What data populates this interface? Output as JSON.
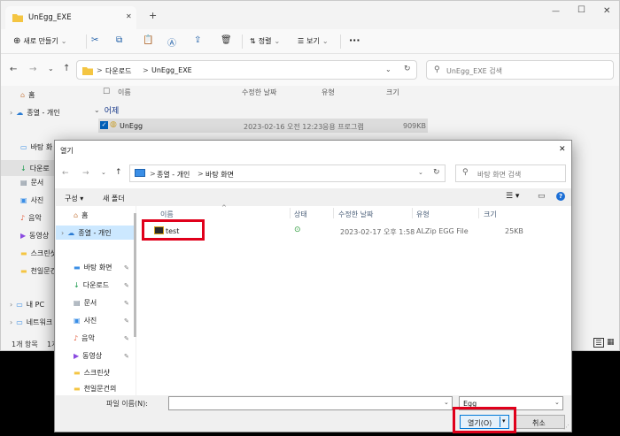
{
  "explorer": {
    "tab_title": "UnEgg_EXE",
    "toolbar": {
      "new_label": "새로 만들기",
      "sort_label": "정렬",
      "view_label": "보기",
      "more_label": "···"
    },
    "breadcrumb": {
      "sep1": ">",
      "part1": "다운로드",
      "sep2": ">",
      "part2": "UnEgg_EXE"
    },
    "search_placeholder": "UnEgg_EXE 검색",
    "nav": {
      "home": "홈",
      "onedrive": "종열 - 개인",
      "desktop": "바탕 화",
      "downloads": "다운로",
      "documents": "문서",
      "pictures": "사진",
      "music": "음악",
      "videos": "동영상",
      "screenshots": "스크린샷",
      "chunil": "천일문건",
      "thispc": "내 PC",
      "network": "네트워크"
    },
    "columns": {
      "name": "이름",
      "modified": "수정한 날짜",
      "type": "유형",
      "size": "크기"
    },
    "group_label": "어제",
    "file": {
      "name": "UnEgg",
      "modified": "2023-02-16 오전 12:23",
      "type": "응용 프로그램",
      "size": "909KB"
    },
    "status": {
      "count": "1개 항목",
      "selected": "1개"
    }
  },
  "dialog": {
    "title": "열기",
    "close_glyph": "✕",
    "breadcrumb": {
      "sep1": ">",
      "part1": "종열 - 개인",
      "sep2": ">",
      "part2": "바탕 화면"
    },
    "search_placeholder": "바탕 화면 검색",
    "organize_label": "구성 ▾",
    "new_folder_label": "새 폴더",
    "nav": {
      "home": "홈",
      "onedrive": "종열 - 개인",
      "desktop": "바탕 화면",
      "downloads": "다운로드",
      "documents": "문서",
      "pictures": "사진",
      "music": "음악",
      "videos": "동영상",
      "screenshots": "스크린샷",
      "chunil": "천일문건의"
    },
    "columns": {
      "name": "이름",
      "status": "상태",
      "modified": "수정한 날짜",
      "type": "유형",
      "size": "크기"
    },
    "file": {
      "name": "test",
      "modified": "2023-02-17 오후 1:58",
      "type": "ALZip EGG File",
      "size": "25KB"
    },
    "filename_label": "파일 이름(N):",
    "filename_value": "",
    "filetype_value": "Egg",
    "open_label": "열기(O)",
    "cancel_label": "취소"
  },
  "colors": {
    "highlight": "#e0001b",
    "folder": "#f4c542",
    "accent": "#005fb8"
  }
}
